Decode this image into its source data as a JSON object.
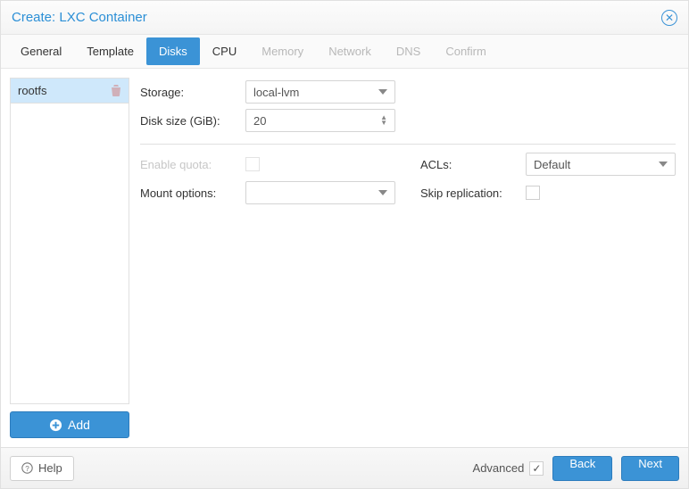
{
  "title": "Create: LXC Container",
  "tabs": [
    {
      "label": "General",
      "state": "enabled"
    },
    {
      "label": "Template",
      "state": "enabled"
    },
    {
      "label": "Disks",
      "state": "active"
    },
    {
      "label": "CPU",
      "state": "enabled"
    },
    {
      "label": "Memory",
      "state": "disabled"
    },
    {
      "label": "Network",
      "state": "disabled"
    },
    {
      "label": "DNS",
      "state": "disabled"
    },
    {
      "label": "Confirm",
      "state": "disabled"
    }
  ],
  "sidebar": {
    "items": [
      {
        "label": "rootfs"
      }
    ],
    "add_label": "Add"
  },
  "form": {
    "storage": {
      "label": "Storage:",
      "value": "local-lvm"
    },
    "disk_size": {
      "label": "Disk size (GiB):",
      "value": "20"
    },
    "enable_quota": {
      "label": "Enable quota:",
      "checked": false,
      "disabled": true
    },
    "mount_options": {
      "label": "Mount options:",
      "value": ""
    },
    "acls": {
      "label": "ACLs:",
      "value": "Default"
    },
    "skip_replication": {
      "label": "Skip replication:",
      "checked": false
    }
  },
  "footer": {
    "help": "Help",
    "advanced": "Advanced",
    "advanced_checked": true,
    "back": "Back",
    "next": "Next"
  }
}
